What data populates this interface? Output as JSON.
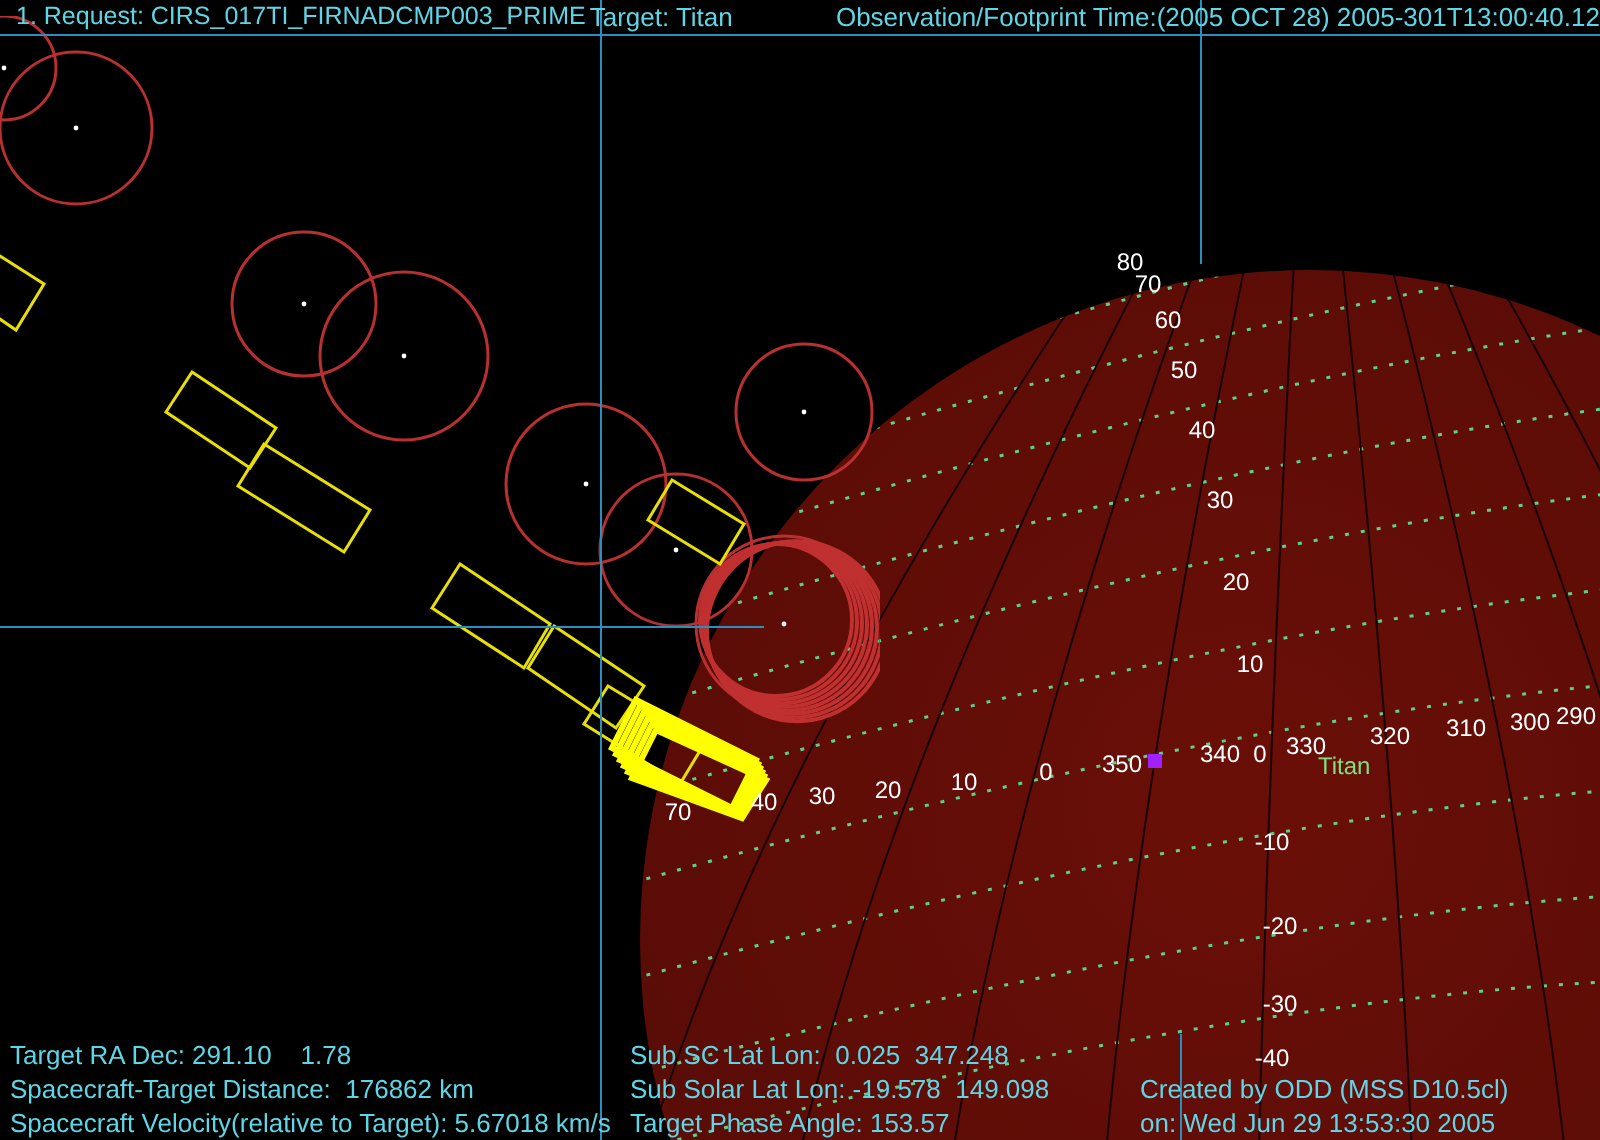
{
  "header": {
    "request": "1. Request: CIRS_017TI_FIRNADCMP003_PRIME",
    "target": "Target: Titan",
    "time": "Observation/Footprint Time:(2005 OCT 28) 2005-301T13:00:40.12"
  },
  "lat_labels": [
    "80",
    "70",
    "60",
    "50",
    "40",
    "30",
    "20",
    "10",
    "-10",
    "-20",
    "-30",
    "-40"
  ],
  "lon_labels": [
    "70",
    "40",
    "30",
    "20",
    "10",
    "0",
    "350",
    "340",
    "0",
    "330",
    "320",
    "310",
    "300",
    "290"
  ],
  "target_label": "Titan",
  "footer": {
    "left": [
      "Target RA Dec: 291.10    1.78",
      "Spacecraft-Target Distance:  176862 km",
      "Spacecraft Velocity(relative to Target): 5.67018 km/s"
    ],
    "middle": [
      "Sub SC Lat Lon:  0.025  347.248",
      "Sub Solar Lat Lon: -19.578  149.098",
      "Target Phase Angle: 153.57"
    ],
    "right": [
      "Created by ODD (MSS D10.5cl)",
      "on: Wed Jun 29 13:53:30 2005"
    ]
  }
}
